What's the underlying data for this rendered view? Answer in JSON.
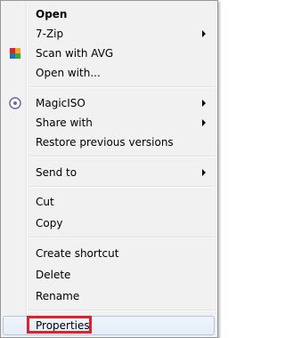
{
  "menu": {
    "items": {
      "open": "Open",
      "seven_zip": "7-Zip",
      "scan_avg": "Scan with AVG",
      "open_with": "Open with...",
      "magiciso": "MagicISO",
      "share_with": "Share with",
      "restore": "Restore previous versions",
      "send_to": "Send to",
      "cut": "Cut",
      "copy": "Copy",
      "create_shortcut": "Create shortcut",
      "delete": "Delete",
      "rename": "Rename",
      "properties": "Properties"
    },
    "icons": {
      "scan_avg": "avg-icon",
      "magiciso": "magiciso-icon"
    },
    "colors": {
      "highlight_border": "#e2202b"
    }
  }
}
